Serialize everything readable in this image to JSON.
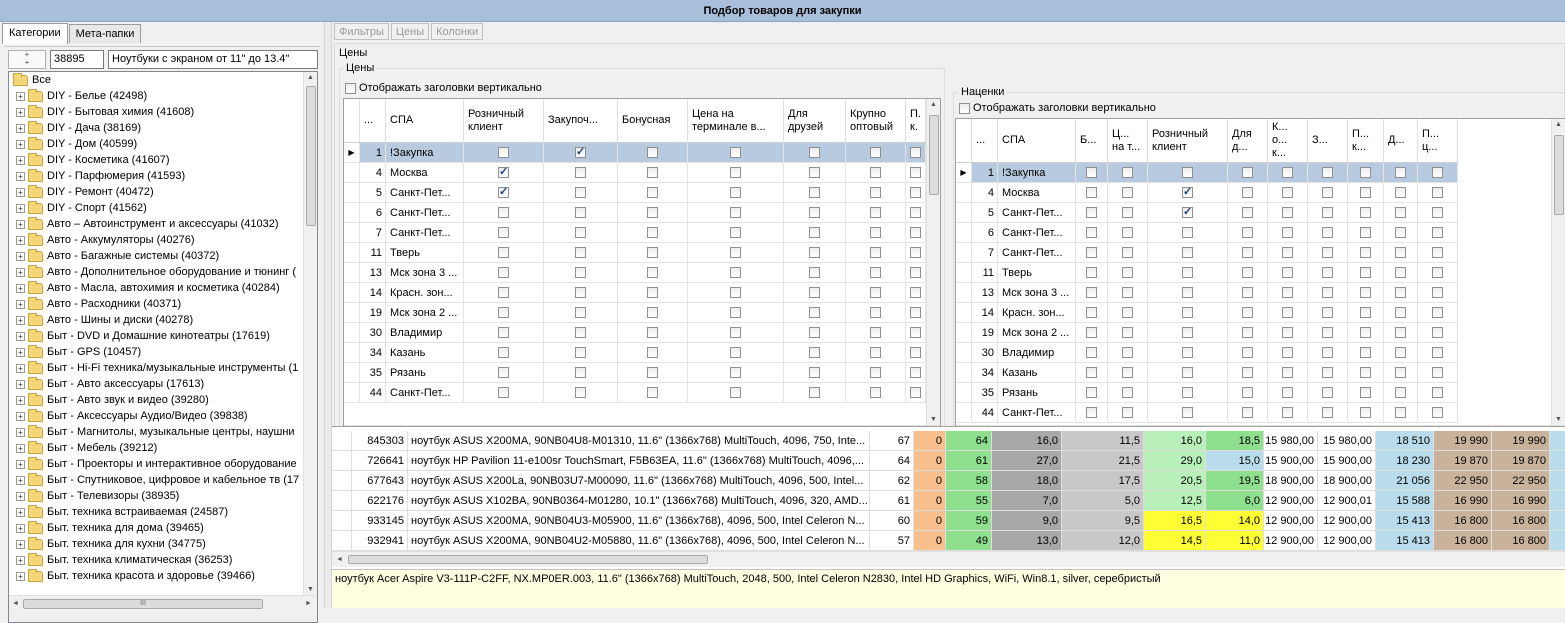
{
  "window": {
    "title": "Подбор товаров для закупки"
  },
  "left_tabs": [
    {
      "label": "Категории",
      "active": true
    },
    {
      "label": "Мета-папки",
      "active": false
    }
  ],
  "filter": {
    "id_value": "38895",
    "name_value": "Ноутбуки с экраном от 11\" до 13.4\""
  },
  "tree": {
    "root": "Все",
    "items": [
      "DIY - Белье (42498)",
      "DIY - Бытовая химия (41608)",
      "DIY - Дача (38169)",
      "DIY - Дом (40599)",
      "DIY - Косметика (41607)",
      "DIY - Парфюмерия (41593)",
      "DIY - Ремонт (40472)",
      "DIY - Спорт (41562)",
      "Авто – Автоинструмент и аксессуары (41032)",
      "Авто - Аккумуляторы (40276)",
      "Авто - Багажные системы (40372)",
      "Авто - Дополнительное оборудование и тюнинг (",
      "Авто - Масла, автохимия и косметика (40284)",
      "Авто - Расходники (40371)",
      "Авто - Шины и диски (40278)",
      "Быт - DVD и Домашние кинотеатры (17619)",
      "Быт - GPS (10457)",
      "Быт - Hi-Fi техника/музыкальные инструменты (1",
      "Быт - Авто аксессуары (17613)",
      "Быт - Авто звук и видео (39280)",
      "Быт - Аксессуары Аудио/Видео (39838)",
      "Быт - Магнитолы, музыкальные центры, наушни",
      "Быт - Мебель (39212)",
      "Быт - Проекторы и интерактивное оборудование",
      "Быт - Спутниковое, цифровое и кабельное тв (17",
      "Быт - Телевизоры (38935)",
      "Быт. техника встраиваемая (24587)",
      "Быт. техника для дома (39465)",
      "Быт. техника для кухни (34775)",
      "Быт. техника климатическая (36253)",
      "Быт. техника красота и здоровье (39466)"
    ]
  },
  "right_tabs": [
    "Фильтры",
    "Цены",
    "Колонки"
  ],
  "ceny_outer_label": "Цены",
  "prices": {
    "label": "Цены",
    "vertical_headers_label": "Отображать заголовки вертикально",
    "headers": [
      "...",
      "СПА",
      "Розничный клиент",
      "Закупоч...",
      "Бонусная",
      "Цена на терминале в...",
      "Для друзей",
      "Крупно оптовый",
      "П. к."
    ],
    "rows": [
      {
        "n": "1",
        "spa": "!Закупка",
        "checks": [
          false,
          true,
          false,
          false,
          false,
          false,
          false
        ],
        "selected": true
      },
      {
        "n": "4",
        "spa": "Москва",
        "checks": [
          true,
          false,
          false,
          false,
          false,
          false,
          false
        ]
      },
      {
        "n": "5",
        "spa": "Санкт-Пет...",
        "checks": [
          true,
          false,
          false,
          false,
          false,
          false,
          false
        ]
      },
      {
        "n": "6",
        "spa": "Санкт-Пет...",
        "checks": [
          false,
          false,
          false,
          false,
          false,
          false,
          false
        ]
      },
      {
        "n": "7",
        "spa": "Санкт-Пет...",
        "checks": [
          false,
          false,
          false,
          false,
          false,
          false,
          false
        ]
      },
      {
        "n": "11",
        "spa": "Тверь",
        "checks": [
          false,
          false,
          false,
          false,
          false,
          false,
          false
        ]
      },
      {
        "n": "13",
        "spa": "Мск зона 3 ...",
        "checks": [
          false,
          false,
          false,
          false,
          false,
          false,
          false
        ]
      },
      {
        "n": "14",
        "spa": "Красн. зон...",
        "checks": [
          false,
          false,
          false,
          false,
          false,
          false,
          false
        ]
      },
      {
        "n": "19",
        "spa": "Мск зона 2 ...",
        "checks": [
          false,
          false,
          false,
          false,
          false,
          false,
          false
        ]
      },
      {
        "n": "30",
        "spa": "Владимир",
        "checks": [
          false,
          false,
          false,
          false,
          false,
          false,
          false
        ]
      },
      {
        "n": "34",
        "spa": "Казань",
        "checks": [
          false,
          false,
          false,
          false,
          false,
          false,
          false
        ]
      },
      {
        "n": "35",
        "spa": "Рязань",
        "checks": [
          false,
          false,
          false,
          false,
          false,
          false,
          false
        ]
      },
      {
        "n": "44",
        "spa": "Санкт-Пет...",
        "checks": [
          false,
          false,
          false,
          false,
          false,
          false,
          false
        ]
      }
    ]
  },
  "markups": {
    "label": "Наценки",
    "vertical_headers_label": "Отображать заголовки вертикально",
    "headers": [
      "...",
      "СПА",
      "Б...",
      "Ц... на т...",
      "Розничный клиент",
      "Для д...",
      "К... о... к...",
      "З...",
      "П... к...",
      "Д...",
      "П... ц..."
    ],
    "rows": [
      {
        "n": "1",
        "spa": "!Закупка",
        "checks": [
          false,
          false,
          false,
          false,
          false,
          false,
          false,
          false,
          false
        ],
        "selected": true
      },
      {
        "n": "4",
        "spa": "Москва",
        "checks": [
          false,
          false,
          true,
          false,
          false,
          false,
          false,
          false,
          false
        ]
      },
      {
        "n": "5",
        "spa": "Санкт-Пет...",
        "checks": [
          false,
          false,
          true,
          false,
          false,
          false,
          false,
          false,
          false
        ]
      },
      {
        "n": "6",
        "spa": "Санкт-Пет...",
        "checks": [
          false,
          false,
          false,
          false,
          false,
          false,
          false,
          false,
          false
        ]
      },
      {
        "n": "7",
        "spa": "Санкт-Пет...",
        "checks": [
          false,
          false,
          false,
          false,
          false,
          false,
          false,
          false,
          false
        ]
      },
      {
        "n": "11",
        "spa": "Тверь",
        "checks": [
          false,
          false,
          false,
          false,
          false,
          false,
          false,
          false,
          false
        ]
      },
      {
        "n": "13",
        "spa": "Мск зона 3 ...",
        "checks": [
          false,
          false,
          false,
          false,
          false,
          false,
          false,
          false,
          false
        ]
      },
      {
        "n": "14",
        "spa": "Красн. зон...",
        "checks": [
          false,
          false,
          false,
          false,
          false,
          false,
          false,
          false,
          false
        ]
      },
      {
        "n": "19",
        "spa": "Мск зона 2 ...",
        "checks": [
          false,
          false,
          false,
          false,
          false,
          false,
          false,
          false,
          false
        ]
      },
      {
        "n": "30",
        "spa": "Владимир",
        "checks": [
          false,
          false,
          false,
          false,
          false,
          false,
          false,
          false,
          false
        ]
      },
      {
        "n": "34",
        "spa": "Казань",
        "checks": [
          false,
          false,
          false,
          false,
          false,
          false,
          false,
          false,
          false
        ]
      },
      {
        "n": "35",
        "spa": "Рязань",
        "checks": [
          false,
          false,
          false,
          false,
          false,
          false,
          false,
          false,
          false
        ]
      },
      {
        "n": "44",
        "spa": "Санкт-Пет...",
        "checks": [
          false,
          false,
          false,
          false,
          false,
          false,
          false,
          false,
          false
        ]
      }
    ]
  },
  "products": {
    "colors": {
      "orange": "#f7c08c",
      "green": "#8ee08e",
      "gray": "#a8a8a8",
      "lightgray": "#c8c8c8",
      "yellow": "#ffff33",
      "lightblue": "#b8dcec",
      "tan": "#c9b29b",
      "lightgreen": "#b9f0b9"
    },
    "rows": [
      {
        "id": "845303",
        "name": "ноутбук ASUS X200MA, 90NB04U8-M01310, 11.6\" (1366x768) MultiTouch, 4096, 750, Inte...",
        "c1": "67",
        "c2": "0",
        "c3": "64",
        "c4": "16,0",
        "c5": "11,5",
        "c6": "16,0",
        "c7": "18,5",
        "c8": "15 980,00",
        "c9": "15 980,00",
        "c10": "18 510",
        "c11": "19 990",
        "c12": "19 990",
        "c6color": "lightgreen",
        "c7color": "green"
      },
      {
        "id": "726641",
        "name": "ноутбук HP Pavilion 11-e100sr TouchSmart, F5B63EA, 11.6\" (1366x768) MultiTouch, 4096,...",
        "c1": "64",
        "c2": "0",
        "c3": "61",
        "c4": "27,0",
        "c5": "21,5",
        "c6": "29,0",
        "c7": "15,0",
        "c8": "15 900,00",
        "c9": "15 900,00",
        "c10": "18 230",
        "c11": "19 870",
        "c12": "19 870",
        "c6color": "lightgreen",
        "c7color": "lightblue"
      },
      {
        "id": "677643",
        "name": "ноутбук ASUS X200La, 90NB03U7-M00090, 11.6\" (1366x768) MultiTouch, 4096, 500, Intel...",
        "c1": "62",
        "c2": "0",
        "c3": "58",
        "c4": "18,0",
        "c5": "17,5",
        "c6": "20,5",
        "c7": "19,5",
        "c8": "18 900,00",
        "c9": "18 900,00",
        "c10": "21 056",
        "c11": "22 950",
        "c12": "22 950",
        "c6color": "lightgreen",
        "c7color": "green"
      },
      {
        "id": "622176",
        "name": "ноутбук ASUS X102BA, 90NB0364-M01280, 10.1\" (1366x768) MultiTouch, 4096, 320, AMD...",
        "c1": "61",
        "c2": "0",
        "c3": "55",
        "c4": "7,0",
        "c5": "5,0",
        "c6": "12,5",
        "c7": "6,0",
        "c8": "12 900,00",
        "c9": "12 900,01",
        "c10": "15 588",
        "c11": "16 990",
        "c12": "16 990",
        "c6color": "lightgreen",
        "c7color": "green"
      },
      {
        "id": "933145",
        "name": "ноутбук ASUS X200MA, 90NB04U3-M05900, 11.6\" (1366x768), 4096, 500, Intel Celeron N...",
        "c1": "60",
        "c2": "0",
        "c3": "59",
        "c4": "9,0",
        "c5": "9,5",
        "c6": "16,5",
        "c7": "14,0",
        "c8": "12 900,00",
        "c9": "12 900,00",
        "c10": "15 413",
        "c11": "16 800",
        "c12": "16 800",
        "c6color": "yellow",
        "c7color": "yellow"
      },
      {
        "id": "932941",
        "name": "ноутбук ASUS X200MA, 90NB04U2-M05880, 11.6\" (1366x768), 4096, 500, Intel Celeron N...",
        "c1": "57",
        "c2": "0",
        "c3": "49",
        "c4": "13,0",
        "c5": "12,0",
        "c6": "14,5",
        "c7": "11,0",
        "c8": "12 900,00",
        "c9": "12 900,00",
        "c10": "15 413",
        "c11": "16 800",
        "c12": "16 800",
        "c6color": "yellow",
        "c7color": "yellow"
      }
    ]
  },
  "status": {
    "text": "ноутбук Acer Aspire V3-111P-C2FF, NX.MP0ER.003, 11.6\" (1366x768) MultiTouch, 2048, 500, Intel Celeron N2830, Intel HD Graphics, WiFi, Win8.1, silver, серебристый"
  },
  "scroll_glyphs": {
    "up": "▲",
    "down": "▼",
    "left": "◄",
    "right": "►",
    "grip": "III"
  },
  "icons": {
    "expander": "+",
    "row_indicator": "▶",
    "filter_plus": "+"
  }
}
